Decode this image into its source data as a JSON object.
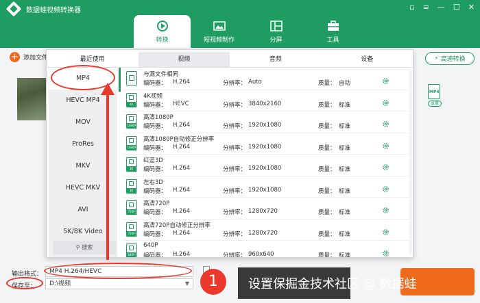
{
  "app": {
    "title": "数据蛙视频转换器"
  },
  "window_buttons": [
    "▫",
    "≡",
    "—",
    "☐",
    "✕"
  ],
  "main_tabs": [
    {
      "label": "转换",
      "icon": "convert-icon",
      "active": true
    },
    {
      "label": "短视频制作",
      "icon": "image-icon",
      "active": false
    },
    {
      "label": "分屏",
      "icon": "split-screen-icon",
      "active": false
    },
    {
      "label": "工具",
      "icon": "toolbox-icon",
      "active": false
    }
  ],
  "toolbar": {
    "add_file_label": "添加文件",
    "fast_convert_label": "高速转换"
  },
  "format_badge": {
    "label": "MP4",
    "settings_label": "设置"
  },
  "popup": {
    "tabs": [
      "最近使用",
      "视频",
      "音频",
      "设备"
    ],
    "active_tab": 1,
    "sidebar": [
      "MP4",
      "HEVC MP4",
      "MOV",
      "ProRes",
      "MKV",
      "HEVC MKV",
      "AVI",
      "5K/8K Video"
    ],
    "search_label": "搜索",
    "encoder_label": "编码器：",
    "resolution_label": "分辨率：",
    "quality_label": "质量：",
    "rows": [
      {
        "name": "与源文件相同",
        "encoder": "H.264",
        "resolution": "Auto",
        "quality": "自动",
        "badge": ""
      },
      {
        "name": "4K视频",
        "encoder": "HEVC",
        "resolution": "3840x2160",
        "quality": "标准",
        "badge": "4K"
      },
      {
        "name": "高清1080P",
        "encoder": "H.264",
        "resolution": "1920x1080",
        "quality": "标准",
        "badge": "1080P"
      },
      {
        "name": "高清1080P自动修正分辨率",
        "encoder": "H.264",
        "resolution": "1920x1080",
        "quality": "标准",
        "badge": "1080P"
      },
      {
        "name": "红蓝3D",
        "encoder": "H.264",
        "resolution": "1920x1080",
        "quality": "标准",
        "badge": "3D"
      },
      {
        "name": "左右3D",
        "encoder": "H.264",
        "resolution": "1920x1080",
        "quality": "标准",
        "badge": "3D"
      },
      {
        "name": "高清720P",
        "encoder": "H.264",
        "resolution": "1280x720",
        "quality": "标准",
        "badge": "720P"
      },
      {
        "name": "高清720P自动修正分辨率",
        "encoder": "H.264",
        "resolution": "1280x720",
        "quality": "标准",
        "badge": "720P"
      },
      {
        "name": "640P",
        "encoder": "H.264",
        "resolution": "960x640",
        "quality": "标准",
        "badge": "640P"
      }
    ]
  },
  "bottom": {
    "output_format_label": "输出格式：",
    "output_format_value": "MP4 H.264/HEVC",
    "save_to_label": "保存至：",
    "save_to_value": "D:\\视频"
  },
  "annotation": {
    "step_number": "1",
    "text": "设置保掘金技术社区 @ 数据蛙"
  }
}
